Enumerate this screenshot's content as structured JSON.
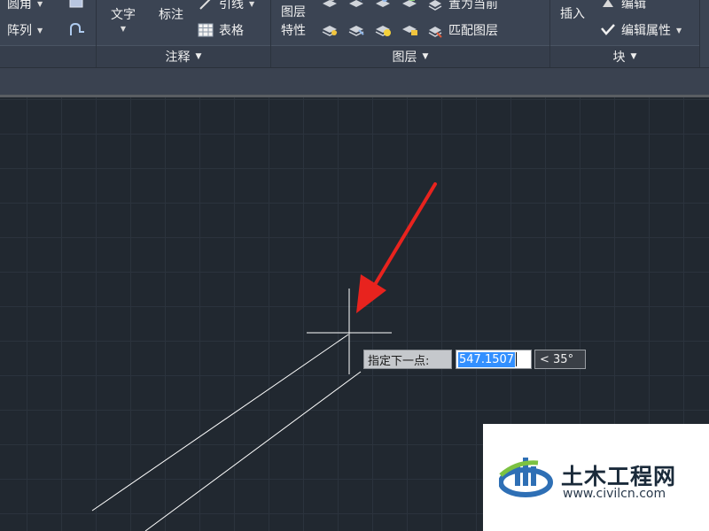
{
  "ribbon": {
    "modify": {
      "fillet_label": "圆角",
      "array_label": "阵列"
    },
    "annotation": {
      "text_label": "文字",
      "dimension_label": "标注",
      "leader_label": "引线",
      "table_label": "表格",
      "panel_title": "注释"
    },
    "layers": {
      "layer_properties_label_1": "图层",
      "layer_properties_label_2": "特性",
      "set_current_label": "置为当前",
      "match_layer_label": "匹配图层",
      "panel_title": "图层"
    },
    "block": {
      "insert_label": "插入",
      "edit_label": "编辑",
      "edit_attributes_label": "编辑属性",
      "panel_title": "块"
    }
  },
  "dynamic_input": {
    "prompt": "指定下一点:",
    "distance_value": "547.1507",
    "angle_value": "< 35°"
  },
  "watermark": {
    "title": "土木工程网",
    "url": "www.civilcn.com"
  },
  "colors": {
    "canvas_bg": "#212830",
    "ribbon_bg": "#3b4453",
    "arrow": "#e8231e",
    "selection": "#3390ff"
  }
}
